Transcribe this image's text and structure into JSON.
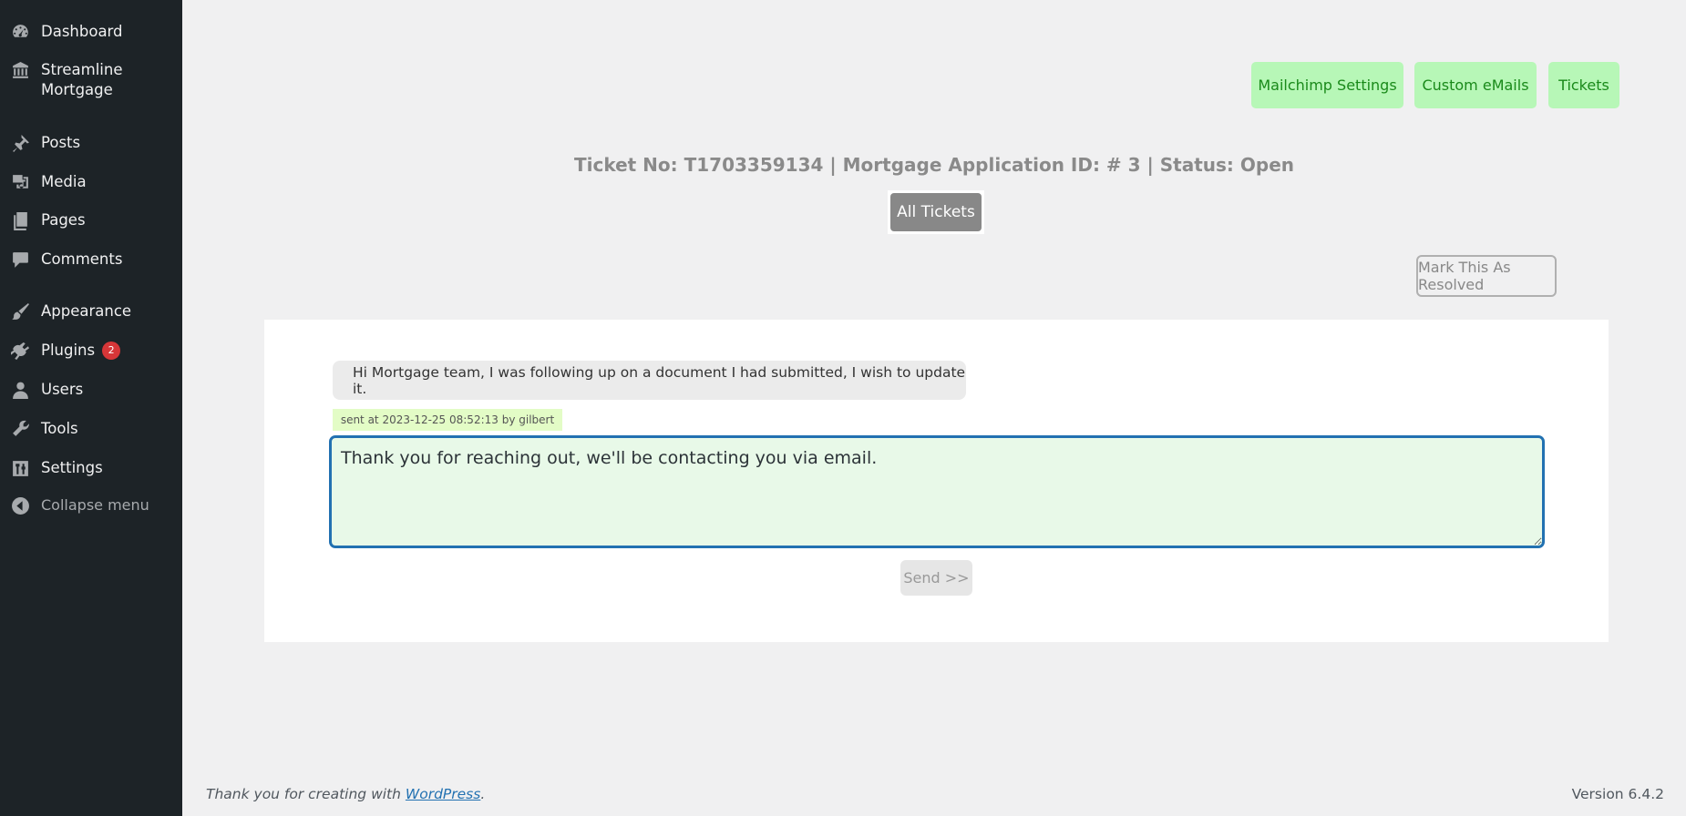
{
  "sidebar": {
    "items": [
      {
        "label": "Dashboard",
        "icon": "dashboard-icon"
      },
      {
        "label": "Streamline Mortgage",
        "icon": "bank-icon"
      },
      {
        "label": "Posts",
        "icon": "pin-icon"
      },
      {
        "label": "Media",
        "icon": "media-icon"
      },
      {
        "label": "Pages",
        "icon": "pages-icon"
      },
      {
        "label": "Comments",
        "icon": "comment-icon"
      },
      {
        "label": "Appearance",
        "icon": "brush-icon"
      },
      {
        "label": "Plugins",
        "icon": "plugin-icon",
        "badge": "2"
      },
      {
        "label": "Users",
        "icon": "user-icon"
      },
      {
        "label": "Tools",
        "icon": "wrench-icon"
      },
      {
        "label": "Settings",
        "icon": "settings-icon"
      }
    ],
    "collapse_label": "Collapse menu"
  },
  "top_nav": {
    "mailchimp": "Mailchimp Settings",
    "custom_emails": "Custom eMails",
    "tickets": "Tickets"
  },
  "ticket": {
    "title": "Ticket No: T1703359134 | Mortgage Application ID: # 3 | Status: Open",
    "all_tickets_label": "All Tickets",
    "resolve_label": "Mark This As Resolved"
  },
  "conversation": {
    "message": "Hi Mortgage team, I was following up on a document I had submitted, I wish to update it.",
    "meta": "sent at 2023-12-25 08:52:13 by gilbert"
  },
  "reply": {
    "value": "Thank you for reaching out, we'll be contacting you via email.",
    "send_label": "Send >>"
  },
  "footer": {
    "thanks_prefix": "Thank you for creating with ",
    "wordpress_link": "WordPress",
    "thanks_suffix": ".",
    "version": "Version 6.4.2"
  },
  "colors": {
    "sidebar_bg": "#1d2327",
    "accent": "#2271b1",
    "nav_button_bg": "#b7f7b7",
    "nav_button_text": "#1a8a1a",
    "badge": "#d63638"
  }
}
